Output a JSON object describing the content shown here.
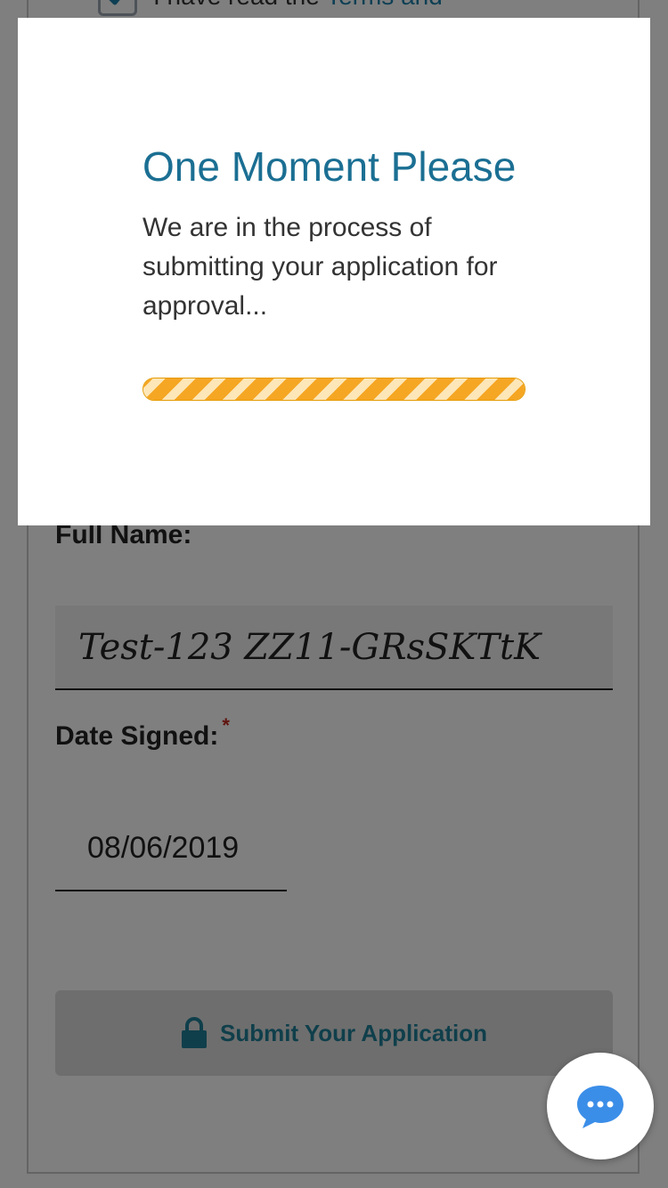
{
  "terms": {
    "prefix": "I have read the ",
    "link": "Terms and"
  },
  "form": {
    "full_name_label": "Full Name:",
    "full_name_value": "Test-123 ZZ11-GRsSKTtK",
    "date_signed_label": "Date Signed:",
    "date_signed_value": "08/06/2019",
    "required_marker": "*",
    "submit_label": "Submit Your Application"
  },
  "modal": {
    "title": "One Moment Please",
    "message": "We are in the process of submitting your application for approval...",
    "progress_percent": 100
  },
  "icons": {
    "checkbox": "check-icon",
    "submit": "lock-icon",
    "chat": "chat-bubble-icon"
  },
  "colors": {
    "title": "#1b6f93",
    "progress": "#f5a623",
    "chat": "#3b8ee8",
    "submit_text": "#1e7e96"
  }
}
